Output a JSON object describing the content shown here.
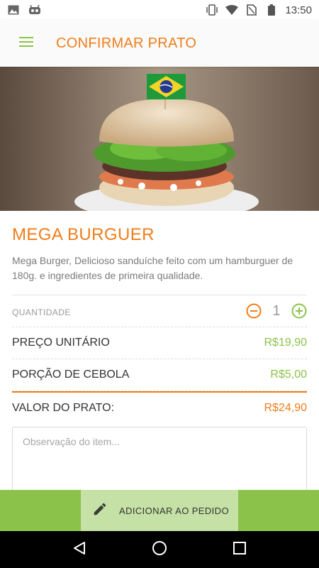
{
  "status_bar": {
    "time": "13:50",
    "left_icons": [
      "image-icon",
      "android-debug-icon"
    ],
    "right_icons": [
      "vibrate-icon",
      "wifi-icon",
      "no-sim-icon",
      "battery-icon"
    ]
  },
  "app_bar": {
    "menu_icon": "hamburger-menu-icon",
    "title": "CONFIRMAR PRATO"
  },
  "dish": {
    "image": "burger-with-brazil-flag",
    "name": "MEGA BURGUER",
    "description": "Mega Burger, Delicioso sanduíche feito com um hamburguer de 180g. e ingredientes de primeira qualidade."
  },
  "quantity": {
    "label": "QUANTIDADE",
    "value": "1",
    "decrement_icon": "minus-circle-icon",
    "increment_icon": "plus-circle-icon"
  },
  "prices": [
    {
      "label": "PREÇO UNITÁRIO",
      "value": "R$19,90"
    },
    {
      "label": "PORÇÃO DE CEBOLA",
      "value": "R$5,00"
    }
  ],
  "total": {
    "label": "VALOR DO PRATO:",
    "value": "R$24,90"
  },
  "observation": {
    "placeholder": "Observação do item...",
    "value": ""
  },
  "action": {
    "label": "ADICIONAR AO PEDIDO",
    "icon": "pencil-icon"
  },
  "nav": [
    "back-icon",
    "home-icon",
    "recents-icon"
  ],
  "colors": {
    "accent_orange": "#f07d1a",
    "accent_green": "#8bc34a",
    "button_light_green": "#c5e1a5"
  }
}
